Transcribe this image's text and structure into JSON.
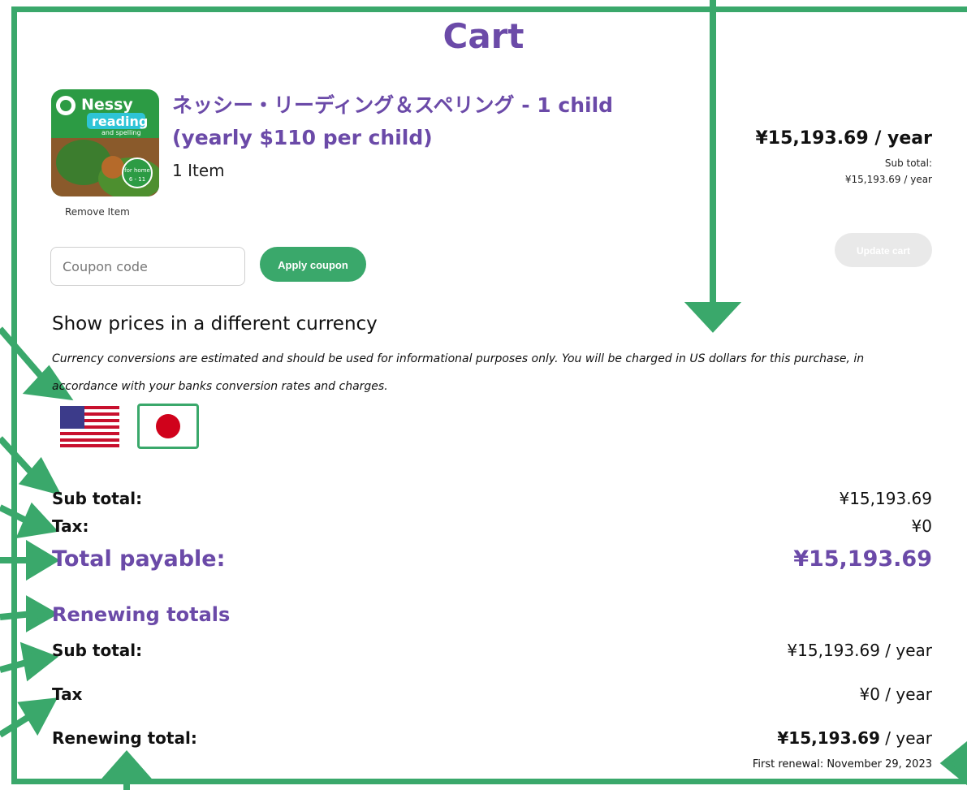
{
  "title": "Cart",
  "product": {
    "name_line1": "ネッシー・リーディング＆スペリング - 1 child",
    "name_line2": "(yearly $110 per child)",
    "quantity": "1 Item",
    "remove_label": "Remove Item",
    "price": "¥15,193.69 / year",
    "subtotal_label": "Sub total:",
    "subtotal_value": "¥15,193.69 / year",
    "image_logo": {
      "line1": "Nessy",
      "line2": "reading",
      "line3": "and spelling",
      "badge": "for home",
      "age": "6 - 11"
    }
  },
  "coupon": {
    "placeholder": "Coupon code",
    "apply_label": "Apply coupon"
  },
  "update_cart_label": "Update cart",
  "currency": {
    "title": "Show prices in a different currency",
    "note": "Currency conversions are estimated and should be used for informational purposes only. You will be charged in US dollars for this purchase, in accordance with your banks conversion rates and charges.",
    "flags": [
      "us-flag-icon",
      "japan-flag-icon"
    ],
    "selected": "japan-flag-icon"
  },
  "totals": {
    "subtotal_label": "Sub total:",
    "subtotal_value": "¥15,193.69",
    "tax_label": "Tax:",
    "tax_value": "¥0",
    "total_label": "Total payable:",
    "total_value": "¥15,193.69"
  },
  "renewing": {
    "heading": "Renewing totals",
    "subtotal_label": "Sub total:",
    "subtotal_value": "¥15,193.69 / year",
    "tax_label": "Tax",
    "tax_value": "¥0 / year",
    "total_label": "Renewing total:",
    "total_amount": "¥15,193.69",
    "total_unit": " / year",
    "first_renewal": "First renewal: November 29, 2023"
  },
  "colors": {
    "accent_green": "#3aa86b",
    "brand_purple": "#6b4aa8"
  }
}
